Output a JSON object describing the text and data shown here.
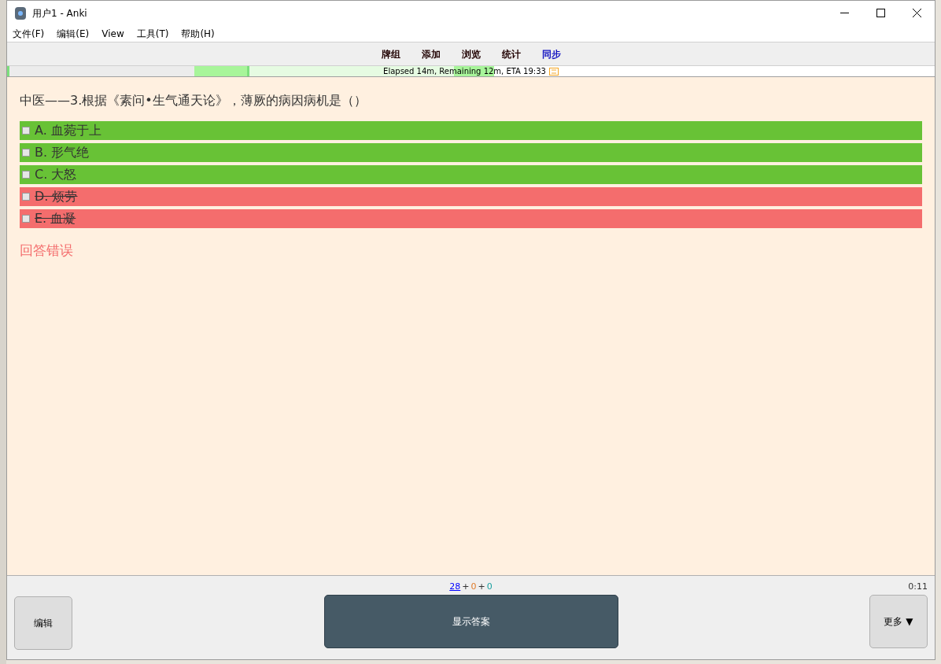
{
  "window": {
    "title": "用户1 - Anki"
  },
  "menu": [
    "文件(F)",
    "编辑(E)",
    "View",
    "工具(T)",
    "帮助(H)"
  ],
  "toplinks": [
    {
      "label": "牌组",
      "highlighted": false
    },
    {
      "label": "添加",
      "highlighted": false
    },
    {
      "label": "浏览",
      "highlighted": false
    },
    {
      "label": "统计",
      "highlighted": false
    },
    {
      "label": "同步",
      "highlighted": true
    }
  ],
  "progress": {
    "text": "Elapsed 14m, Remaining 12m, ETA 19:33",
    "level": 0.525
  },
  "question": "中医——3.根据《素问•生气通天论》，薄厥的病因病机是（）",
  "options": [
    {
      "label": "A. 血菀于上",
      "checked": false,
      "correct": true
    },
    {
      "label": "B. 形气绝",
      "checked": false,
      "correct": true
    },
    {
      "label": "C. 大怒",
      "checked": false,
      "correct": true
    },
    {
      "label": "D. 烦劳",
      "checked": false,
      "correct": false
    },
    {
      "label": "E. 血凝",
      "checked": false,
      "correct": false
    }
  ],
  "result": "回答错误",
  "counts": [
    {
      "value": "28",
      "kind": "new"
    },
    {
      "value": "0",
      "kind": "learning"
    },
    {
      "value": "0",
      "kind": "review"
    }
  ],
  "count_separators": [
    "+",
    "+"
  ],
  "timer": "0:11",
  "buttons": {
    "edit": "编辑",
    "show_answer": "显示答案",
    "more": "更多 ▼"
  }
}
